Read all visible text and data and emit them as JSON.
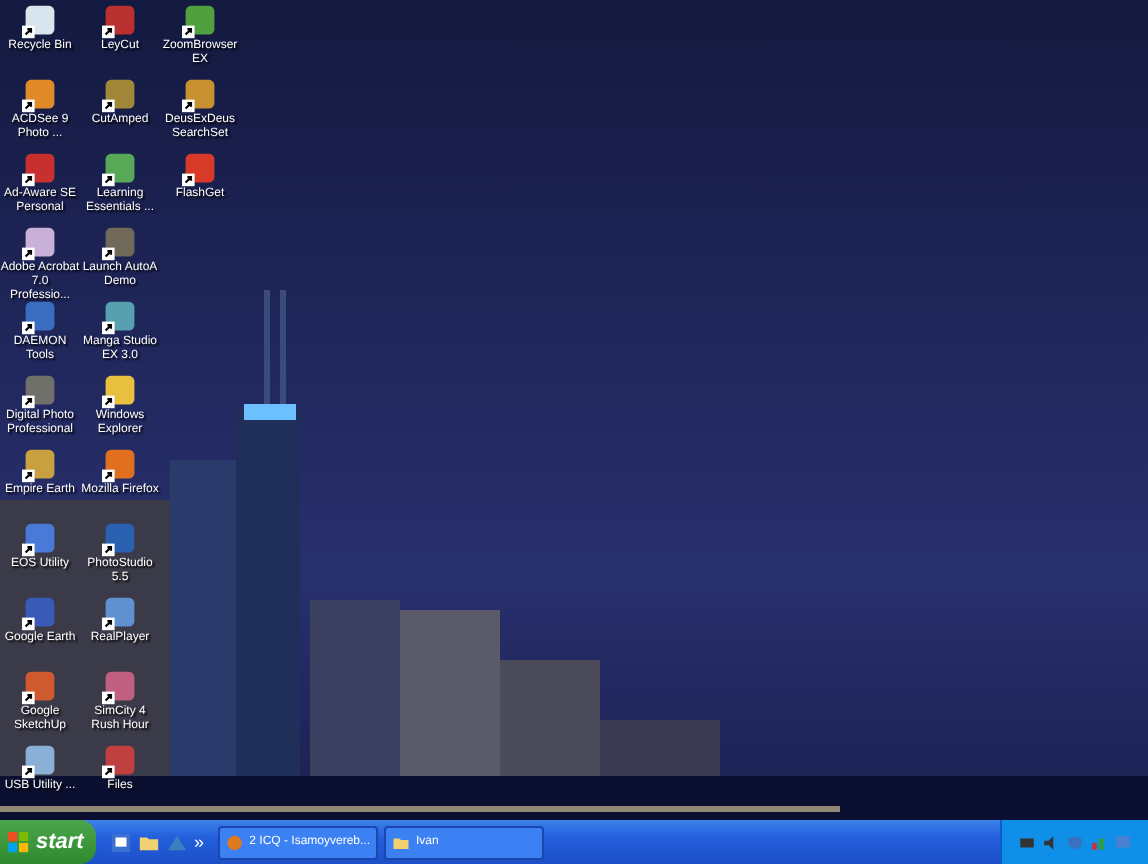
{
  "desktop": {
    "columns": [
      [
        {
          "label": "Recycle Bin"
        },
        {
          "label": "ACDSee 9 Photo ..."
        },
        {
          "label": "Ad-Aware SE Personal"
        },
        {
          "label": "Adobe Acrobat 7.0 Professio..."
        },
        {
          "label": "DAEMON Tools"
        },
        {
          "label": "Digital Photo Professional"
        },
        {
          "label": "Empire Earth"
        },
        {
          "label": "EOS Utility"
        },
        {
          "label": "Google Earth"
        },
        {
          "label": "Google SketchUp"
        },
        {
          "label": "USB Utility ..."
        }
      ],
      [
        {
          "label": "LeyCut"
        },
        {
          "label": "CutAmped"
        },
        {
          "label": "Learning Essentials ..."
        },
        {
          "label": "Launch AutoA Demo"
        },
        {
          "label": "Manga Studio EX 3.0"
        },
        {
          "label": "Windows Explorer"
        },
        {
          "label": "Mozilla Firefox"
        },
        {
          "label": "PhotoStudio 5.5"
        },
        {
          "label": "RealPlayer"
        },
        {
          "label": "SimCity 4 Rush Hour"
        },
        {
          "label": "Files"
        }
      ],
      [
        {
          "label": "ZoomBrowser EX"
        },
        {
          "label": "DeusExDeus SearchSet"
        },
        {
          "label": "FlashGet"
        }
      ]
    ]
  },
  "taskbar": {
    "start": "start",
    "more": "»",
    "tasks": [
      {
        "label": "2 ICQ - Isamoyvereb...",
        "selected": false
      },
      {
        "label": "Ivan",
        "selected": false
      }
    ]
  }
}
